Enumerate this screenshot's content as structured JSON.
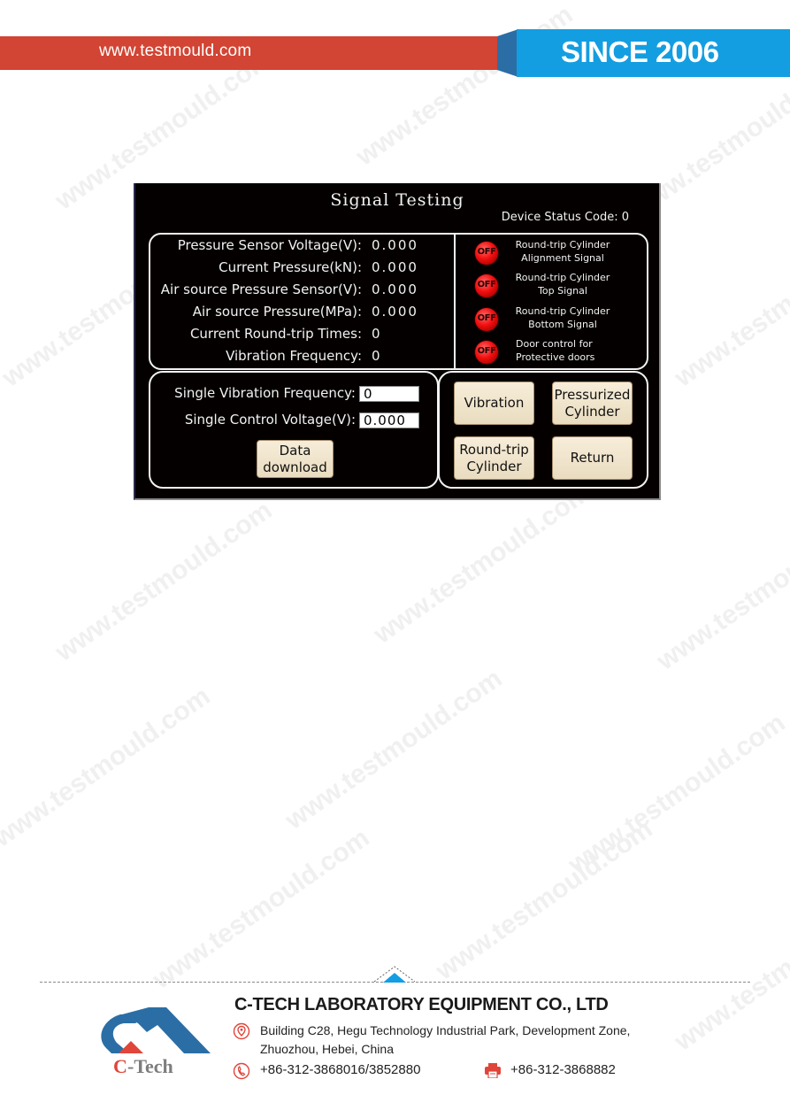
{
  "header": {
    "website": "www.testmould.com",
    "since": "SINCE 2006",
    "colors": {
      "red_band": "#d24433",
      "blue_band": "#149ee2",
      "fold": "#2b6ea5"
    }
  },
  "screen": {
    "title": "Signal Testing",
    "status_code_label": "Device Status Code:",
    "status_code_value": "0",
    "readings": [
      {
        "label": "Pressure Sensor Voltage(V):",
        "value": "0.000"
      },
      {
        "label": "Current Pressure(kN):",
        "value": "0.000"
      },
      {
        "label": "Air source Pressure Sensor(V):",
        "value": "0.000"
      },
      {
        "label": "Air source Pressure(MPa):",
        "value": "0.000"
      },
      {
        "label": "Current Round-trip Times:",
        "value": "0"
      },
      {
        "label": "Vibration Frequency:",
        "value": "0"
      }
    ],
    "signals": [
      {
        "state": "OFF",
        "line1": "Round-trip Cylinder",
        "line2": "Alignment Signal"
      },
      {
        "state": "OFF",
        "line1": "Round-trip Cylinder",
        "line2": "Top Signal"
      },
      {
        "state": "OFF",
        "line1": "Round-trip Cylinder",
        "line2": "Bottom Signal"
      },
      {
        "state": "OFF",
        "line1": "Door control for",
        "line2": "Protective doors"
      }
    ],
    "inputs": [
      {
        "label": "Single Vibration Frequency:",
        "value": "0"
      },
      {
        "label": "Single Control Voltage(V):",
        "value": "0.000"
      }
    ],
    "buttons": {
      "data_download": {
        "line1": "Data",
        "line2": "download"
      },
      "vibration": {
        "line1": "Vibration"
      },
      "pressurized_cylinder": {
        "line1": "Pressurized",
        "line2": "Cylinder"
      },
      "round_trip_cylinder": {
        "line1": "Round-trip",
        "line2": "Cylinder"
      },
      "return": {
        "line1": "Return"
      }
    }
  },
  "footer": {
    "logo_text": "C-Tech",
    "company": "C-TECH LABORATORY EQUIPMENT CO., LTD",
    "address_line1": "Building C28, Hegu Technology Industrial Park, Development Zone,",
    "address_line2": "Zhuozhou, Hebei, China",
    "phone": "+86-312-3868016/3852880",
    "fax": "+86-312-3868882",
    "colors": {
      "icon_red": "#e0453a",
      "logo_blue": "#2b6ea5",
      "accent_blue": "#149ee2"
    }
  },
  "watermark": "www.testmould.com"
}
